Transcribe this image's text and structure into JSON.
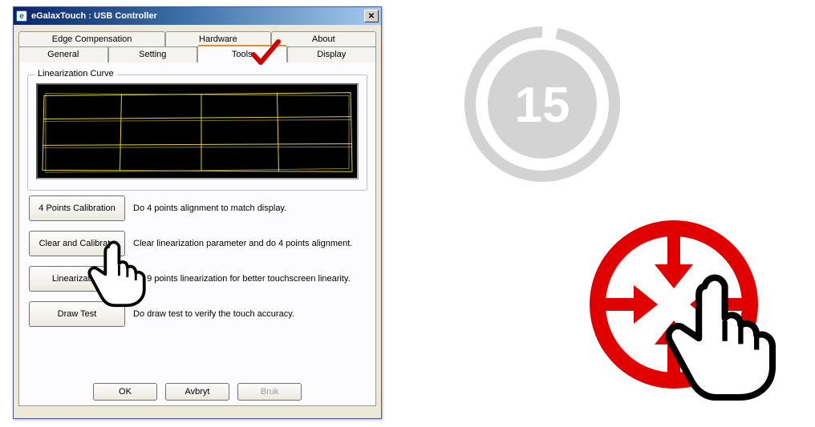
{
  "window": {
    "title": "eGalaxTouch : USB Controller"
  },
  "tabs_row1": [
    {
      "label": "Edge Compensation"
    },
    {
      "label": "Hardware"
    },
    {
      "label": "About"
    }
  ],
  "tabs_row2": [
    {
      "label": "General"
    },
    {
      "label": "Setting"
    },
    {
      "label": "Tools"
    },
    {
      "label": "Display"
    }
  ],
  "group": {
    "legend": "Linearization Curve"
  },
  "actions": [
    {
      "btn": "4 Points Calibration",
      "desc": "Do 4 points alignment to match display."
    },
    {
      "btn": "Clear and Calibrate",
      "desc": "Clear linearization parameter and do 4 points alignment."
    },
    {
      "btn": "Linearization",
      "desc": "Do 9 points linearization for better touchscreen linearity."
    },
    {
      "btn": "Draw Test",
      "desc": "Do draw test to verify the touch accuracy."
    }
  ],
  "bottom": {
    "ok": "OK",
    "cancel": "Avbryt",
    "apply": "Bruk"
  },
  "countdown": {
    "value": "15"
  }
}
